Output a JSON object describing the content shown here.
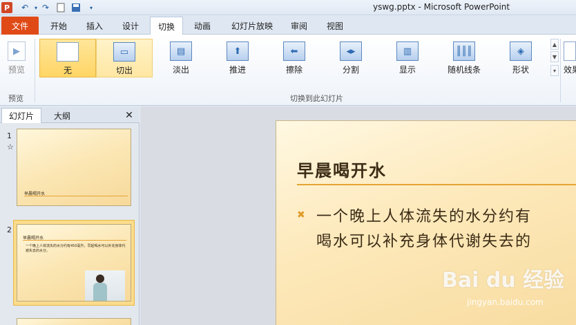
{
  "window": {
    "title": "yswg.pptx - Microsoft PowerPoint",
    "app_logo": "P"
  },
  "ribbon_tabs": [
    {
      "label": "文件"
    },
    {
      "label": "开始"
    },
    {
      "label": "插入"
    },
    {
      "label": "设计"
    },
    {
      "label": "切换"
    },
    {
      "label": "动画"
    },
    {
      "label": "幻灯片放映"
    },
    {
      "label": "审阅"
    },
    {
      "label": "视图"
    }
  ],
  "ribbon": {
    "preview_label": "预览",
    "preview_group_label": "预览",
    "effects_label": "效果",
    "group_label": "切换到此幻灯片",
    "transitions": [
      {
        "label": "无",
        "state": "selected"
      },
      {
        "label": "切出",
        "state": "hover"
      },
      {
        "label": "淡出"
      },
      {
        "label": "推进"
      },
      {
        "label": "擦除"
      },
      {
        "label": "分割"
      },
      {
        "label": "显示"
      },
      {
        "label": "随机线条"
      },
      {
        "label": "形状"
      }
    ]
  },
  "panel": {
    "tabs": [
      {
        "label": "幻灯片"
      },
      {
        "label": "大纲"
      }
    ],
    "close_label": "✕",
    "slides": [
      {
        "number": "1",
        "star": "☆",
        "title": "早晨喝开水",
        "subtitle": "早晨喝开水"
      },
      {
        "number": "2",
        "title": "早晨喝开水",
        "body": "一个晚上人体流失的水分约有450毫升。早起喝水可以补充身体代谢失去的水分。"
      }
    ]
  },
  "slide": {
    "title": "早晨喝开水",
    "bullet": "✖",
    "lines": [
      "一个晚上人体流失的水分约有",
      "喝水可以补充身体代谢失去的"
    ]
  },
  "watermark": {
    "text": "Bai du 经验",
    "sub": "jingyan.baidu.com"
  }
}
